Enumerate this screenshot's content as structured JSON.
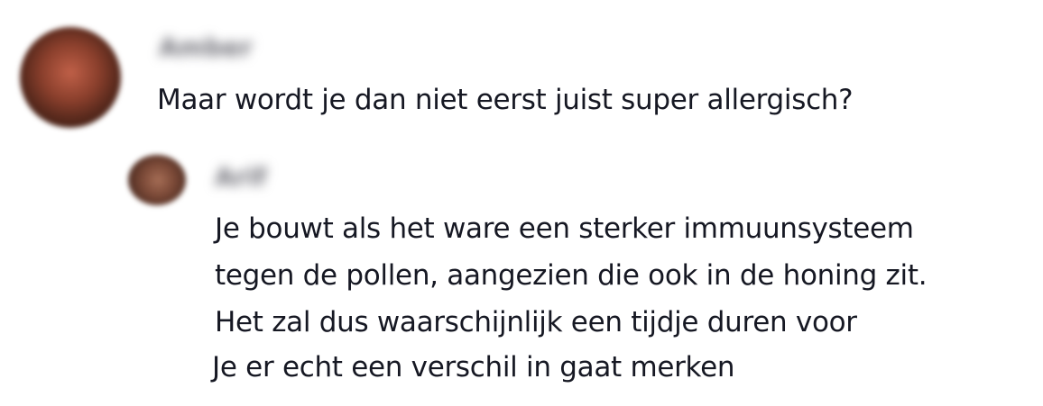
{
  "comment": {
    "username": "Amber",
    "text": "Maar wordt je dan niet eerst juist super allergisch?"
  },
  "reply": {
    "username": "Arif",
    "lines": [
      "Je bouwt als het ware een sterker immuunsysteem",
      "tegen de pollen, aangezien die ook in de honing zit.",
      "Het zal dus waarschijnlijk een tijdje duren voor",
      "Je er echt een verschil in gaat merken"
    ]
  }
}
